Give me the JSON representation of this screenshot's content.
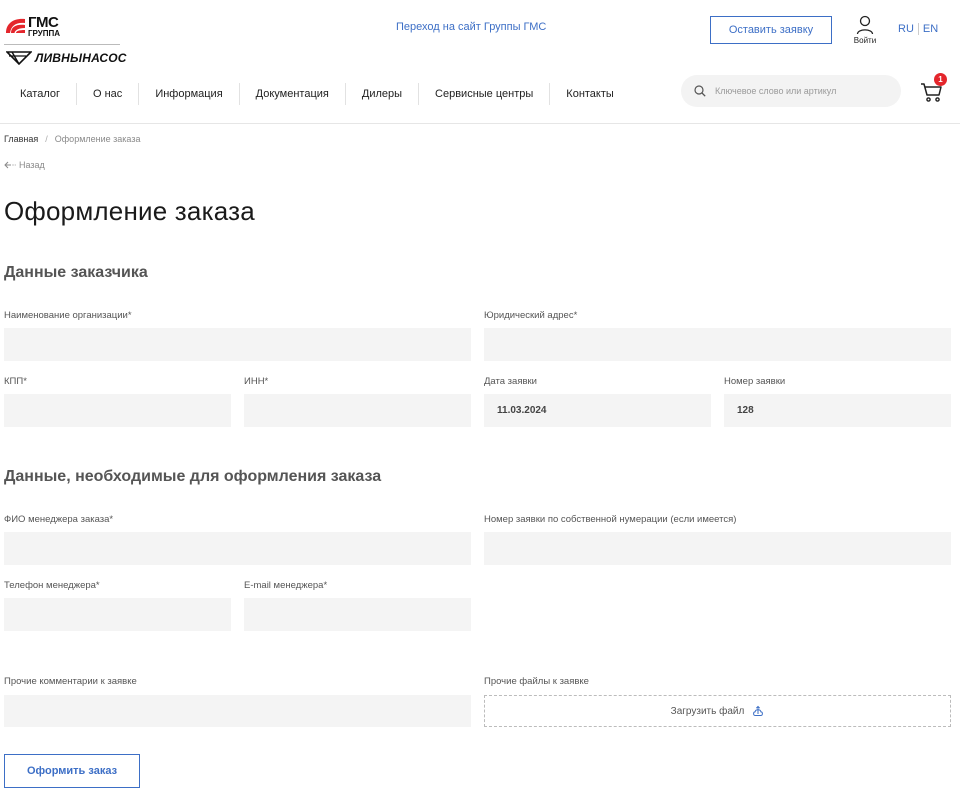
{
  "header": {
    "logo_gms_big": "ГМС",
    "logo_gms_small": "ГРУППА",
    "logo_livny": "ЛИВНЫНАСОС",
    "group_link": "Переход на сайт Группы ГМС",
    "request_button": "Оставить заявку",
    "login_label": "Войти",
    "lang_ru": "RU",
    "lang_en": "EN",
    "accent_color": "#3d6fc6",
    "brand_red": "#e4262c"
  },
  "nav": {
    "items": [
      {
        "label": "Каталог"
      },
      {
        "label": "О нас"
      },
      {
        "label": "Информация"
      },
      {
        "label": "Документация"
      },
      {
        "label": "Дилеры"
      },
      {
        "label": "Сервисные центры"
      },
      {
        "label": "Контакты"
      }
    ]
  },
  "search": {
    "placeholder": "Ключевое слово или артикул",
    "icon": "search-icon"
  },
  "cart": {
    "count": "1",
    "icon": "cart-icon"
  },
  "breadcrumb": {
    "home": "Главная",
    "separator": "/",
    "current": "Оформление заказа"
  },
  "back_label": "Назад",
  "page_title": "Оформление заказа",
  "customer": {
    "title": "Данные заказчика",
    "org_name_label": "Наименование организации*",
    "legal_address_label": "Юридический адрес*",
    "kpp_label": "КПП*",
    "inn_label": "ИНН*",
    "request_date_label": "Дата заявки",
    "request_date_value": "11.03.2024",
    "request_number_label": "Номер заявки",
    "request_number_value": "128"
  },
  "order": {
    "title": "Данные, необходимые для оформления заказа",
    "manager_name_label": "ФИО менеджера заказа*",
    "own_number_label": "Номер заявки по собственной нумерации (если имеется)",
    "manager_phone_label": "Телефон менеджера*",
    "manager_email_label": "E-mail менеджера*",
    "comments_label": "Прочие комментарии к заявке",
    "files_label": "Прочие файлы к заявке",
    "upload_label": "Загрузить файл",
    "submit_label": "Оформить заказ"
  }
}
